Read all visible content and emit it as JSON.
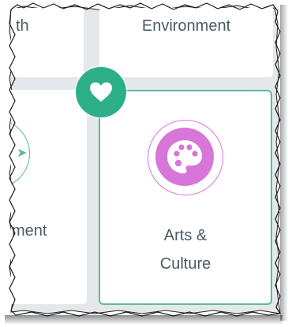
{
  "cards": {
    "health": {
      "label_fragment": "th"
    },
    "environment": {
      "label": "Environment"
    },
    "employment": {
      "label_fragment": "ment"
    },
    "arts": {
      "label_line1": "Arts &",
      "label_line2": "Culture",
      "icon": "palette-icon"
    }
  },
  "favorite": {
    "icon": "heart-icon"
  },
  "colors": {
    "accent_green": "#5cbc95",
    "badge_green": "#2db08a",
    "arts_pink": "#d775d8",
    "text": "#4a5a63",
    "gap": "#e4e8ea"
  }
}
